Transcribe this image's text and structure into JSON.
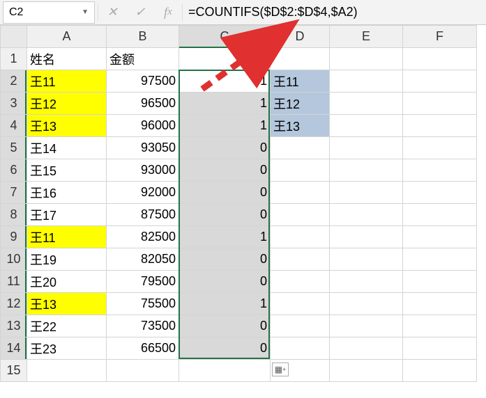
{
  "formula_bar": {
    "name_box": "C2",
    "formula": "=COUNTIFS($D$2:$D$4,$A2)"
  },
  "columns": [
    "A",
    "B",
    "C",
    "D",
    "E",
    "F"
  ],
  "headers": {
    "A": "姓名",
    "B": "金额"
  },
  "rows": [
    {
      "r": 1,
      "A": "姓名",
      "B": "金额",
      "C": "",
      "D": ""
    },
    {
      "r": 2,
      "A": "王11",
      "B": "97500",
      "C": "1",
      "D": "王11"
    },
    {
      "r": 3,
      "A": "王12",
      "B": "96500",
      "C": "1",
      "D": "王12"
    },
    {
      "r": 4,
      "A": "王13",
      "B": "96000",
      "C": "1",
      "D": "王13"
    },
    {
      "r": 5,
      "A": "王14",
      "B": "93050",
      "C": "0",
      "D": ""
    },
    {
      "r": 6,
      "A": "王15",
      "B": "93000",
      "C": "0",
      "D": ""
    },
    {
      "r": 7,
      "A": "王16",
      "B": "92000",
      "C": "0",
      "D": ""
    },
    {
      "r": 8,
      "A": "王17",
      "B": "87500",
      "C": "0",
      "D": ""
    },
    {
      "r": 9,
      "A": "王11",
      "B": "82500",
      "C": "1",
      "D": ""
    },
    {
      "r": 10,
      "A": "王19",
      "B": "82050",
      "C": "0",
      "D": ""
    },
    {
      "r": 11,
      "A": "王20",
      "B": "79500",
      "C": "0",
      "D": ""
    },
    {
      "r": 12,
      "A": "王13",
      "B": "75500",
      "C": "1",
      "D": ""
    },
    {
      "r": 13,
      "A": "王22",
      "B": "73500",
      "C": "0",
      "D": ""
    },
    {
      "r": 14,
      "A": "王23",
      "B": "66500",
      "C": "0",
      "D": ""
    },
    {
      "r": 15,
      "A": "",
      "B": "",
      "C": "",
      "D": ""
    }
  ],
  "yellow_rows_A": [
    2,
    3,
    4,
    9,
    12
  ],
  "blue_rows_D": [
    2,
    3,
    4
  ],
  "gray_rows_C": [
    3,
    4,
    5,
    6,
    7,
    8,
    9,
    10,
    11,
    12,
    13,
    14
  ],
  "selected_col_hdr": "C",
  "selected_row_hdrs": [
    2,
    3,
    4,
    5,
    6,
    7,
    8,
    9,
    10,
    11,
    12,
    13,
    14
  ]
}
